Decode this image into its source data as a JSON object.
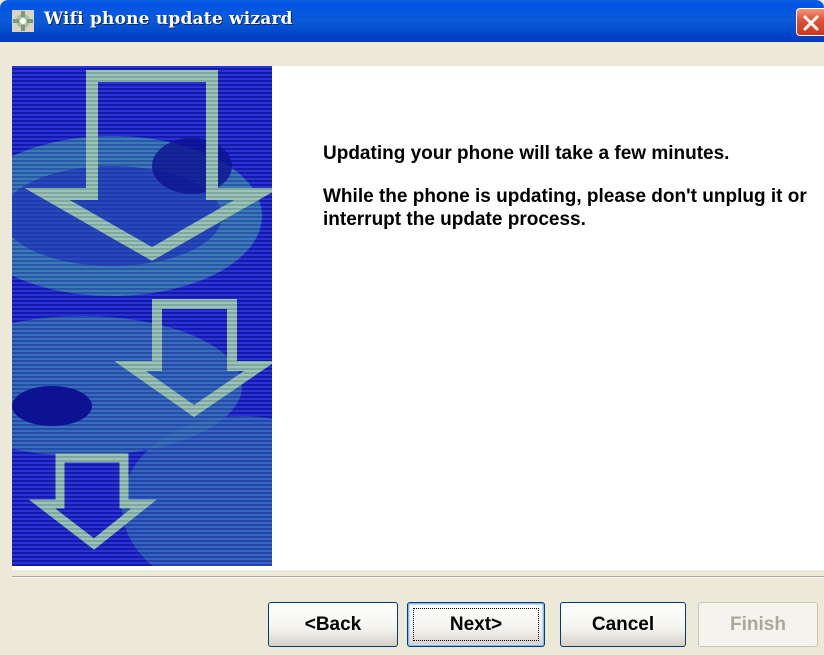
{
  "window": {
    "title": "Wifi phone update wizard"
  },
  "content": {
    "line1": "Updating your phone will take a few minutes.",
    "line2": "While the phone is updating, please don't unplug it or interrupt the update process."
  },
  "buttons": {
    "back": "<Back",
    "next": "Next>",
    "cancel": "Cancel",
    "finish": "Finish"
  },
  "icons": {
    "app": "wizard-app-icon",
    "close": "close-icon",
    "art": "down-arrows-illustration"
  },
  "colors": {
    "titlebar": "#0054e3",
    "close": "#e2543a",
    "art_background": "#1a1fb8",
    "art_arrow": "#8fb7b0",
    "dialog": "#ece9d8"
  }
}
